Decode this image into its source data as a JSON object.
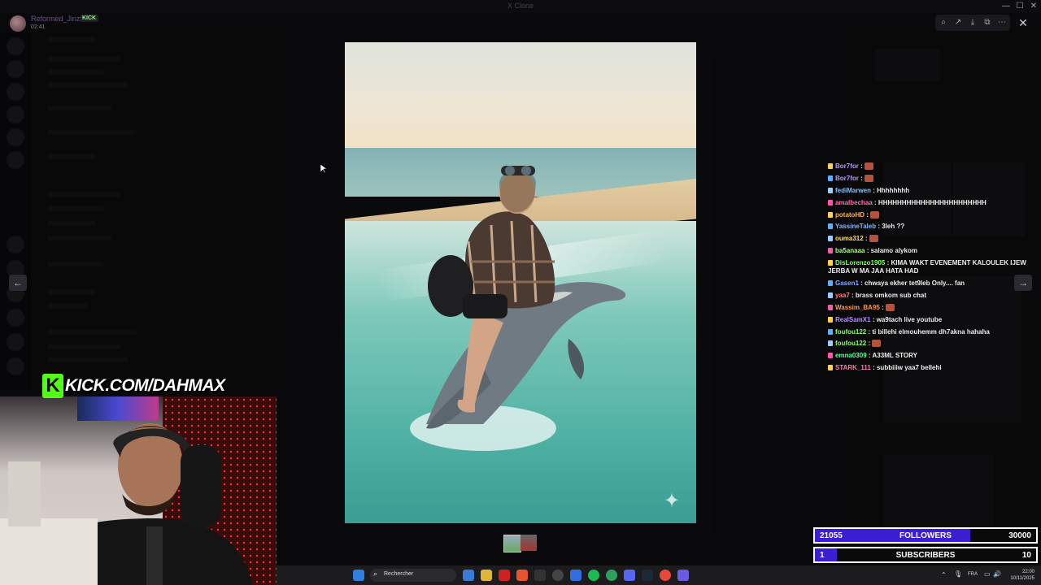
{
  "window": {
    "app_title": "X Clone",
    "controls": [
      "—",
      "☐",
      "✕"
    ]
  },
  "post": {
    "author": "Reformed_Jinzu",
    "badge": "KICK",
    "time": "02:41"
  },
  "toolbar": {
    "icons": [
      "zoom-icon",
      "share-icon",
      "download-icon",
      "open-icon",
      "more-icon"
    ],
    "close": "✕"
  },
  "viewer": {
    "prev": "←",
    "next": "→",
    "sparkle": "✦"
  },
  "chat": [
    {
      "user": "Bor7for",
      "color": "#b49cf0",
      "msg": "",
      "emote": true
    },
    {
      "user": "Bor7for",
      "color": "#b49cf0",
      "msg": "",
      "emote": true
    },
    {
      "user": "fediMarwen",
      "color": "#7fc2ff",
      "msg": "Hhhhhhhh",
      "emote": false
    },
    {
      "user": "amalbechaa",
      "color": "#ff6db0",
      "msg": "HHHHHHHHHHHHHHHHHHHHHHH",
      "emote": false
    },
    {
      "user": "potatoHD",
      "color": "#ffb23c",
      "msg": "",
      "emote": true
    },
    {
      "user": "YassineTaleb",
      "color": "#89b6ff",
      "msg": "3leh ??",
      "emote": false
    },
    {
      "user": "ouma312",
      "color": "#ffe066",
      "msg": "",
      "emote": true
    },
    {
      "user": "ba5anaaa",
      "color": "#a5ff7a",
      "msg": "salamo alykom",
      "emote": false
    },
    {
      "user": "DisLorenzo1905",
      "color": "#7dff5a",
      "msg": "KIMA WAKT EVENEMENT KALOULEK IJEW JERBA W MA JAA HATA HAD",
      "emote": false
    },
    {
      "user": "Gasen1",
      "color": "#7fa8ff",
      "msg": "chwaya ekher tet9leb Only.... fan",
      "emote": false
    },
    {
      "user": "yaa7",
      "color": "#ff7f7f",
      "msg": "brass omkom sub chat",
      "emote": false
    },
    {
      "user": "Wassim_BA95",
      "color": "#ff9a4d",
      "msg": "",
      "emote": true
    },
    {
      "user": "RealSamX1",
      "color": "#b48cff",
      "msg": "wa9tach live youtube",
      "emote": false
    },
    {
      "user": "foufou122",
      "color": "#8dff6a",
      "msg": "ti billehi elmouhemm dh7akna hahaha",
      "emote": false
    },
    {
      "user": "foufou122",
      "color": "#8dff6a",
      "msg": "",
      "emote": true
    },
    {
      "user": "emna0309",
      "color": "#5aff9e",
      "msg": "A33ML STORY",
      "emote": false
    },
    {
      "user": "STARK_111",
      "color": "#ff7ab0",
      "msg": "subbiiiw yaa7 bellehi",
      "emote": false
    }
  ],
  "overlay": {
    "kick_url": "KICK.COM/DAHMAX",
    "kick_logo": "K"
  },
  "goals": {
    "followers": {
      "current": "21055",
      "label": "FOLLOWERS",
      "target": "30000",
      "progress": 0.702
    },
    "subscribers": {
      "current": "1",
      "label": "SUBSCRIBERS",
      "target": "10",
      "progress": 0.1
    }
  },
  "taskbar": {
    "search_placeholder": "Rechercher",
    "language": "FRA",
    "time": "22:00",
    "date": "10/11/2025"
  }
}
